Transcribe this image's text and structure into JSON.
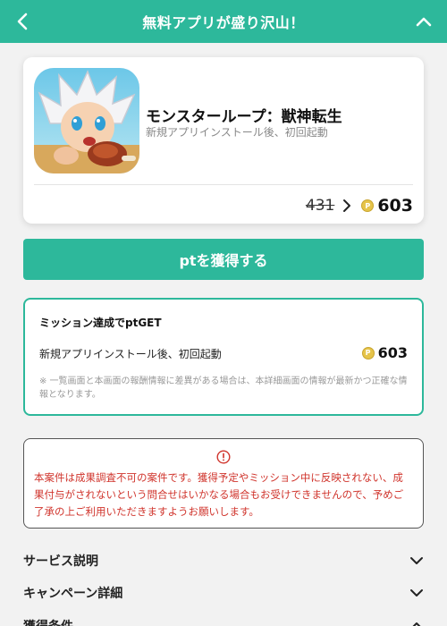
{
  "header": {
    "title": "無料アプリが盛り沢山！",
    "back_icon": "chevron-left-icon",
    "collapse_icon": "chevron-up-icon",
    "color": "#2db89b"
  },
  "app": {
    "name": "モンスターループ：獣神転生",
    "subtitle": "新規アプリインストール後、初回起動",
    "old_points": "431",
    "new_points": "603",
    "coin_icon": "point-coin-icon"
  },
  "get_button": {
    "label": "ptを獲得する"
  },
  "mission": {
    "title": "ミッション達成でptGET",
    "task": "新規アプリインストール後、初回起動",
    "points": "603",
    "note": "※ 一覧画面と本画面の報酬情報に差異がある場合は、本詳細画面の情報が最新かつ正確な情報となります。"
  },
  "warning": {
    "icon": "info-circle-icon",
    "text": "本案件は成果調査不可の案件です。獲得予定やミッション中に反映されない、成果付与がされないという問合せはいかなる場合もお受けできませんので、予めご了承の上ご利用いただきますようお願いします。",
    "color": "#d0342c"
  },
  "sections": [
    {
      "label": "サービス説明"
    },
    {
      "label": "キャンペーン詳細"
    },
    {
      "label": "獲得条件"
    }
  ]
}
